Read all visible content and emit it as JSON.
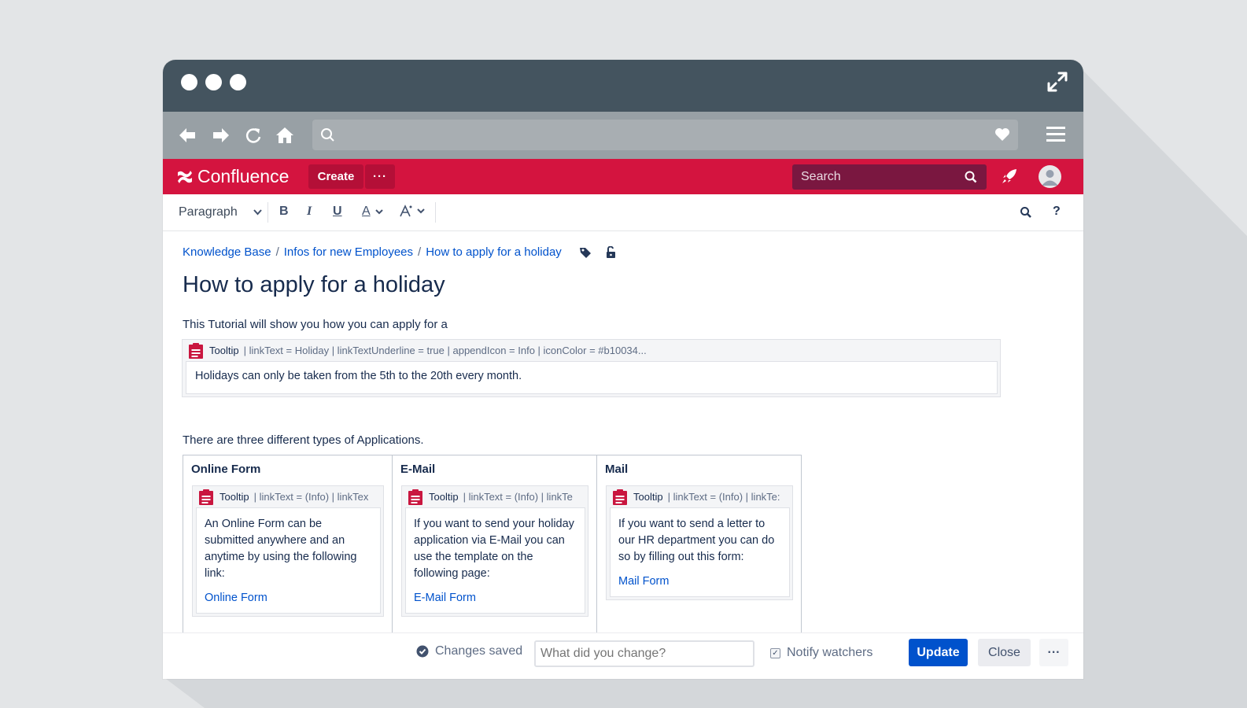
{
  "browser": {
    "titlebar_icons": [
      "window-dot",
      "window-dot",
      "window-dot",
      "expand-icon"
    ],
    "nav_icons": [
      "back-arrow-icon",
      "forward-arrow-icon",
      "reload-icon",
      "home-icon"
    ],
    "url_value": "",
    "menu_icon": "hamburger-icon"
  },
  "confluence_nav": {
    "logo_text": "Confluence",
    "create_label": "Create",
    "more_label": "···",
    "search_placeholder": "Search",
    "brand_color": "#d4143f"
  },
  "toolbar": {
    "paragraph_label": "Paragraph",
    "bold_label": "B",
    "italic_label": "I",
    "underline_label": "U",
    "text_color_label": "A",
    "help_label": "?"
  },
  "page": {
    "breadcrumbs": [
      "Knowledge Base",
      "Infos for new Employees",
      "How to apply for a holiday"
    ],
    "breadcrumb_sep": "/",
    "title": "How to apply for a holiday",
    "intro": "This Tutorial will show you how you can apply for a",
    "main_tooltip": {
      "label": "Tooltip",
      "params": "| linkText = Holiday | linkTextUnderline = true | appendIcon = Info | iconColor = #b10034...",
      "body": "Holidays can only be taken from the 5th to the 20th every month."
    },
    "types_intro": "There are three different types of Applications.",
    "columns": [
      {
        "header": "Online Form",
        "tooltip_label": "Tooltip",
        "tooltip_params": "| linkText = (Info) | linkTex",
        "body": "An Online Form can be submitted anywhere and an anytime by using the following link:",
        "link": "Online Form"
      },
      {
        "header": "E-Mail",
        "tooltip_label": "Tooltip",
        "tooltip_params": "| linkText = (Info) | linkTe",
        "body": "If you want to send your holiday application via E-Mail you can use the template on the following page:",
        "link": "E-Mail Form"
      },
      {
        "header": "Mail",
        "tooltip_label": "Tooltip",
        "tooltip_params": "| linkText = (Info) | linkTe:",
        "body": "If you want to send a letter to our HR department you can do so by filling out this form:",
        "link": "Mail Form"
      }
    ]
  },
  "footer": {
    "saved_label": "Changes saved",
    "change_placeholder": "What did you change?",
    "notify_label": "Notify watchers",
    "update_label": "Update",
    "close_label": "Close",
    "more_label": "···"
  }
}
